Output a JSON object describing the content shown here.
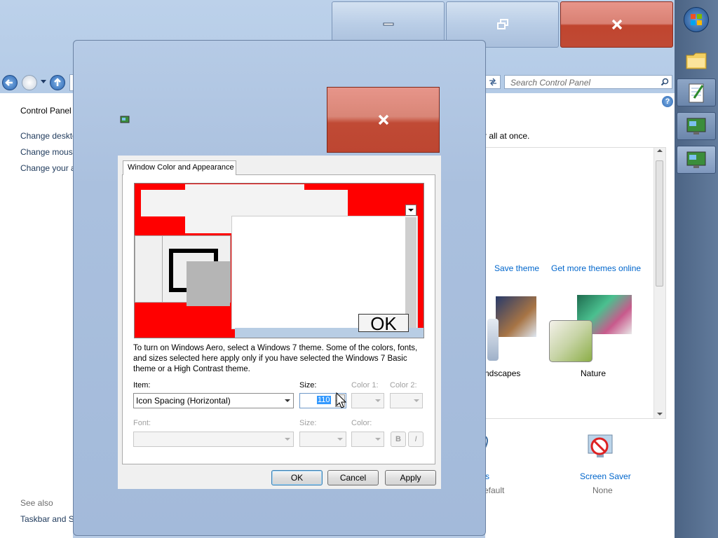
{
  "background_window": {
    "breadcrumb_root": "Control Panel",
    "search_placeholder": "Search Control Panel",
    "left_links": [
      "Control Panel",
      "Change deskto",
      "Change mous",
      "Change your a"
    ],
    "see_also_heading": "See also",
    "see_also_link": "Taskbar and St",
    "partial_text": "r all at once.",
    "save_theme": "Save theme",
    "get_more_themes": "Get more themes online",
    "themes": [
      {
        "name": "ndscapes"
      },
      {
        "name": "Nature"
      }
    ],
    "bottom_items": [
      {
        "label": "s",
        "value": "efault"
      },
      {
        "label": "Screen Saver",
        "value": "None"
      }
    ],
    "help_glyph": "?"
  },
  "dialog": {
    "tab_label": "Window Color and Appearance",
    "preview_ok": "OK",
    "info_text": "To turn on Windows Aero, select a Windows 7 theme.  Some of the colors, fonts, and sizes selected here apply only if you have selected the Windows 7 Basic theme or a High Contrast theme.",
    "item_label": "Item:",
    "item_value": "Icon Spacing (Horizontal)",
    "size_label": "Size:",
    "size_value": "110",
    "color1_label": "Color 1:",
    "color2_label": "Color 2:",
    "font_label": "Font:",
    "font_size_label": "Size:",
    "font_color_label": "Color:",
    "bold_label": "B",
    "italic_label": "I",
    "ok_button": "OK",
    "cancel_button": "Cancel",
    "apply_button": "Apply"
  },
  "colors": {
    "preview_red": "#ff0000",
    "close_red": "#c04a35",
    "link_blue": "#0066cc"
  }
}
